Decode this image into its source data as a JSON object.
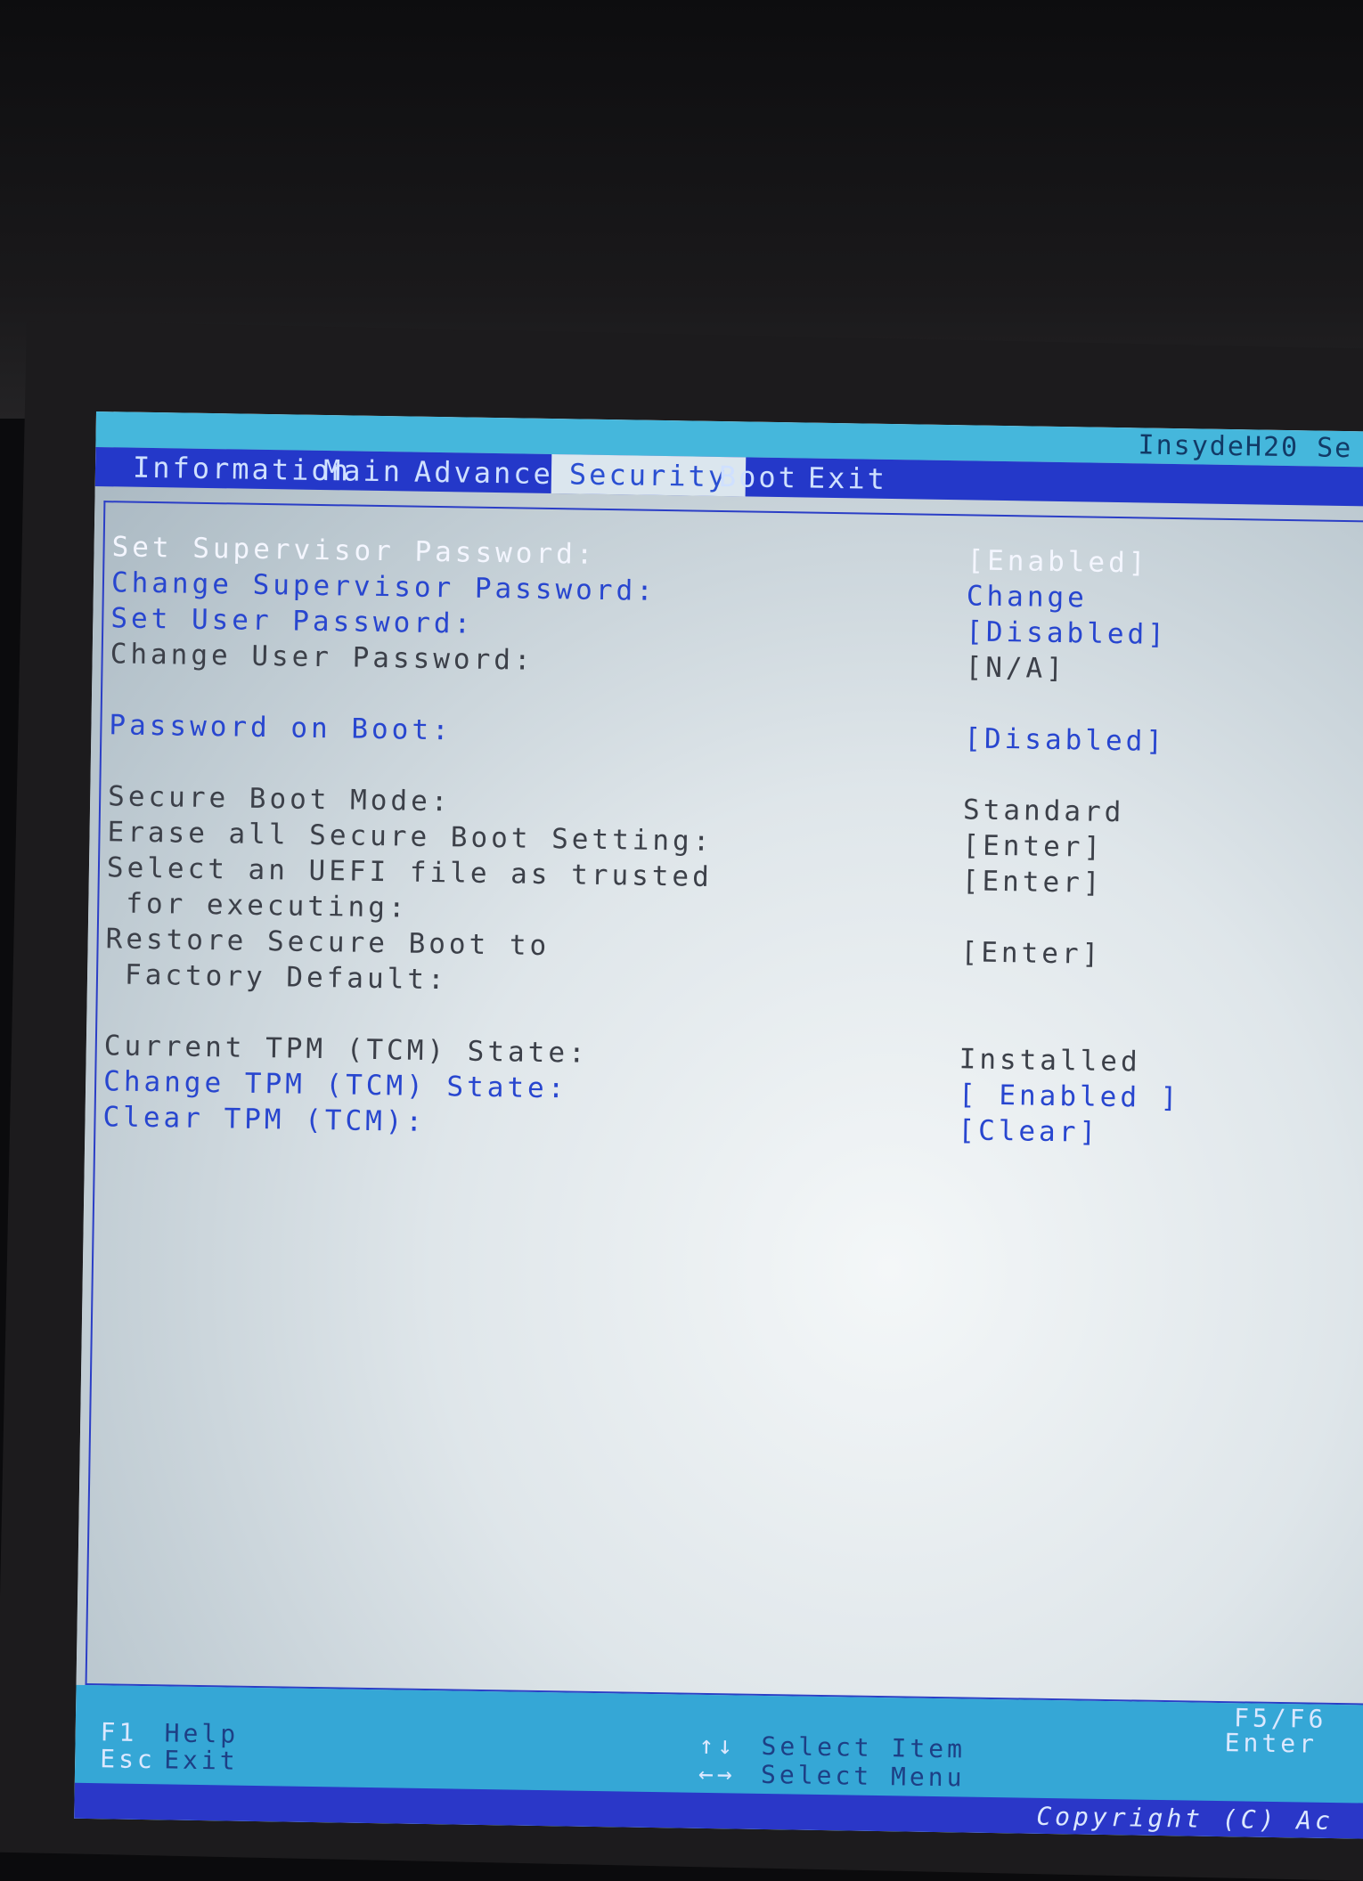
{
  "header": {
    "brand": "InsydeH20 Se"
  },
  "tabs": [
    {
      "label": "Information"
    },
    {
      "label": "Main"
    },
    {
      "label": "Advanced"
    },
    {
      "label": "Security"
    },
    {
      "label": "Boot"
    },
    {
      "label": "Exit"
    }
  ],
  "security": {
    "rows": [
      {
        "label": "Set Supervisor Password:",
        "value": "[Enabled]"
      },
      {
        "label": "Change Supervisor Password:",
        "value": "Change"
      },
      {
        "label": "Set User Password:",
        "value": "[Disabled]"
      },
      {
        "label": "Change User Password:",
        "value": "[N/A]"
      },
      {
        "label": "Password on Boot:",
        "value": "[Disabled]"
      },
      {
        "label": "Secure Boot Mode:",
        "value": "Standard"
      },
      {
        "label": "Erase all Secure Boot Setting:",
        "value": "[Enter]"
      },
      {
        "label": "Select an UEFI file as trusted",
        "label2": "for executing:",
        "value": "[Enter]"
      },
      {
        "label": "Restore Secure Boot to",
        "label2": "Factory Default:",
        "value": "[Enter]"
      },
      {
        "label": "Current TPM (TCM) State:",
        "value": "Installed"
      },
      {
        "label": "Change TPM (TCM) State:",
        "value": "[ Enabled ]"
      },
      {
        "label": "Clear TPM (TCM):",
        "value": "[Clear]"
      }
    ]
  },
  "footer": {
    "f1_key": "F1",
    "f1_label": "Help",
    "esc_key": "Esc",
    "esc_label": "Exit",
    "updown_icon": "↑↓",
    "updown_label": "Select Item",
    "leftright_icon": "←→",
    "leftright_label": "Select Menu",
    "f5f6": "F5/F6",
    "enter": "Enter",
    "copyright": "Copyright (C) Ac"
  }
}
